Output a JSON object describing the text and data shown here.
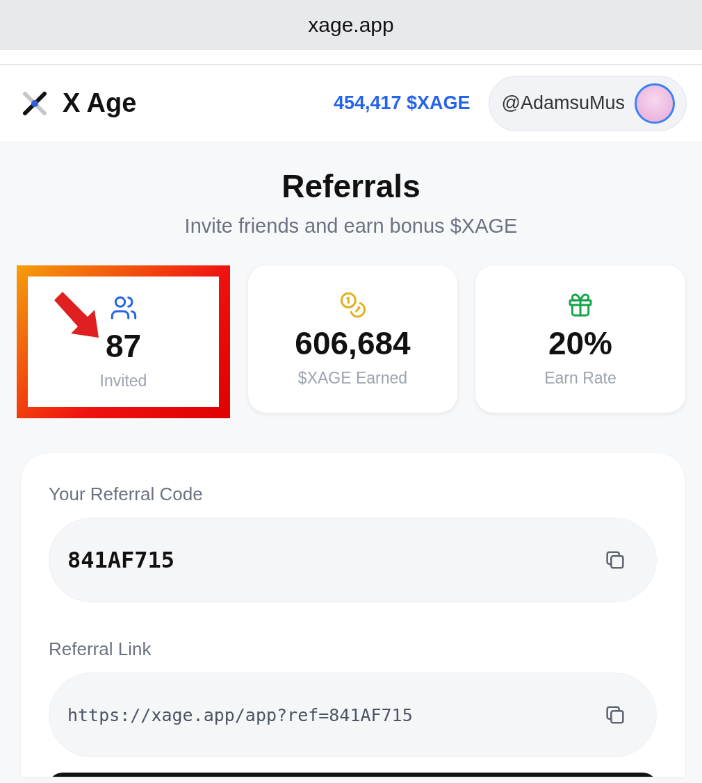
{
  "browser": {
    "address": "xage.app"
  },
  "header": {
    "brand": "X Age",
    "balance": "454,417 $XAGE",
    "username": "@AdamsuMus"
  },
  "page": {
    "title": "Referrals",
    "subtitle": "Invite friends and earn bonus $XAGE"
  },
  "stats": [
    {
      "kind": "people",
      "value": "87",
      "label": "Invited",
      "highlighted": true
    },
    {
      "kind": "coins",
      "value": "606,684",
      "label": "$XAGE Earned",
      "highlighted": false
    },
    {
      "kind": "gift",
      "value": "20%",
      "label": "Earn Rate",
      "highlighted": false
    }
  ],
  "referral": {
    "fields": [
      {
        "kind": "code",
        "label": "Your Referral Code",
        "value": "841AF715"
      },
      {
        "kind": "link",
        "label": "Referral Link",
        "value": "https://xage.app/app?ref=841AF715"
      }
    ]
  }
}
